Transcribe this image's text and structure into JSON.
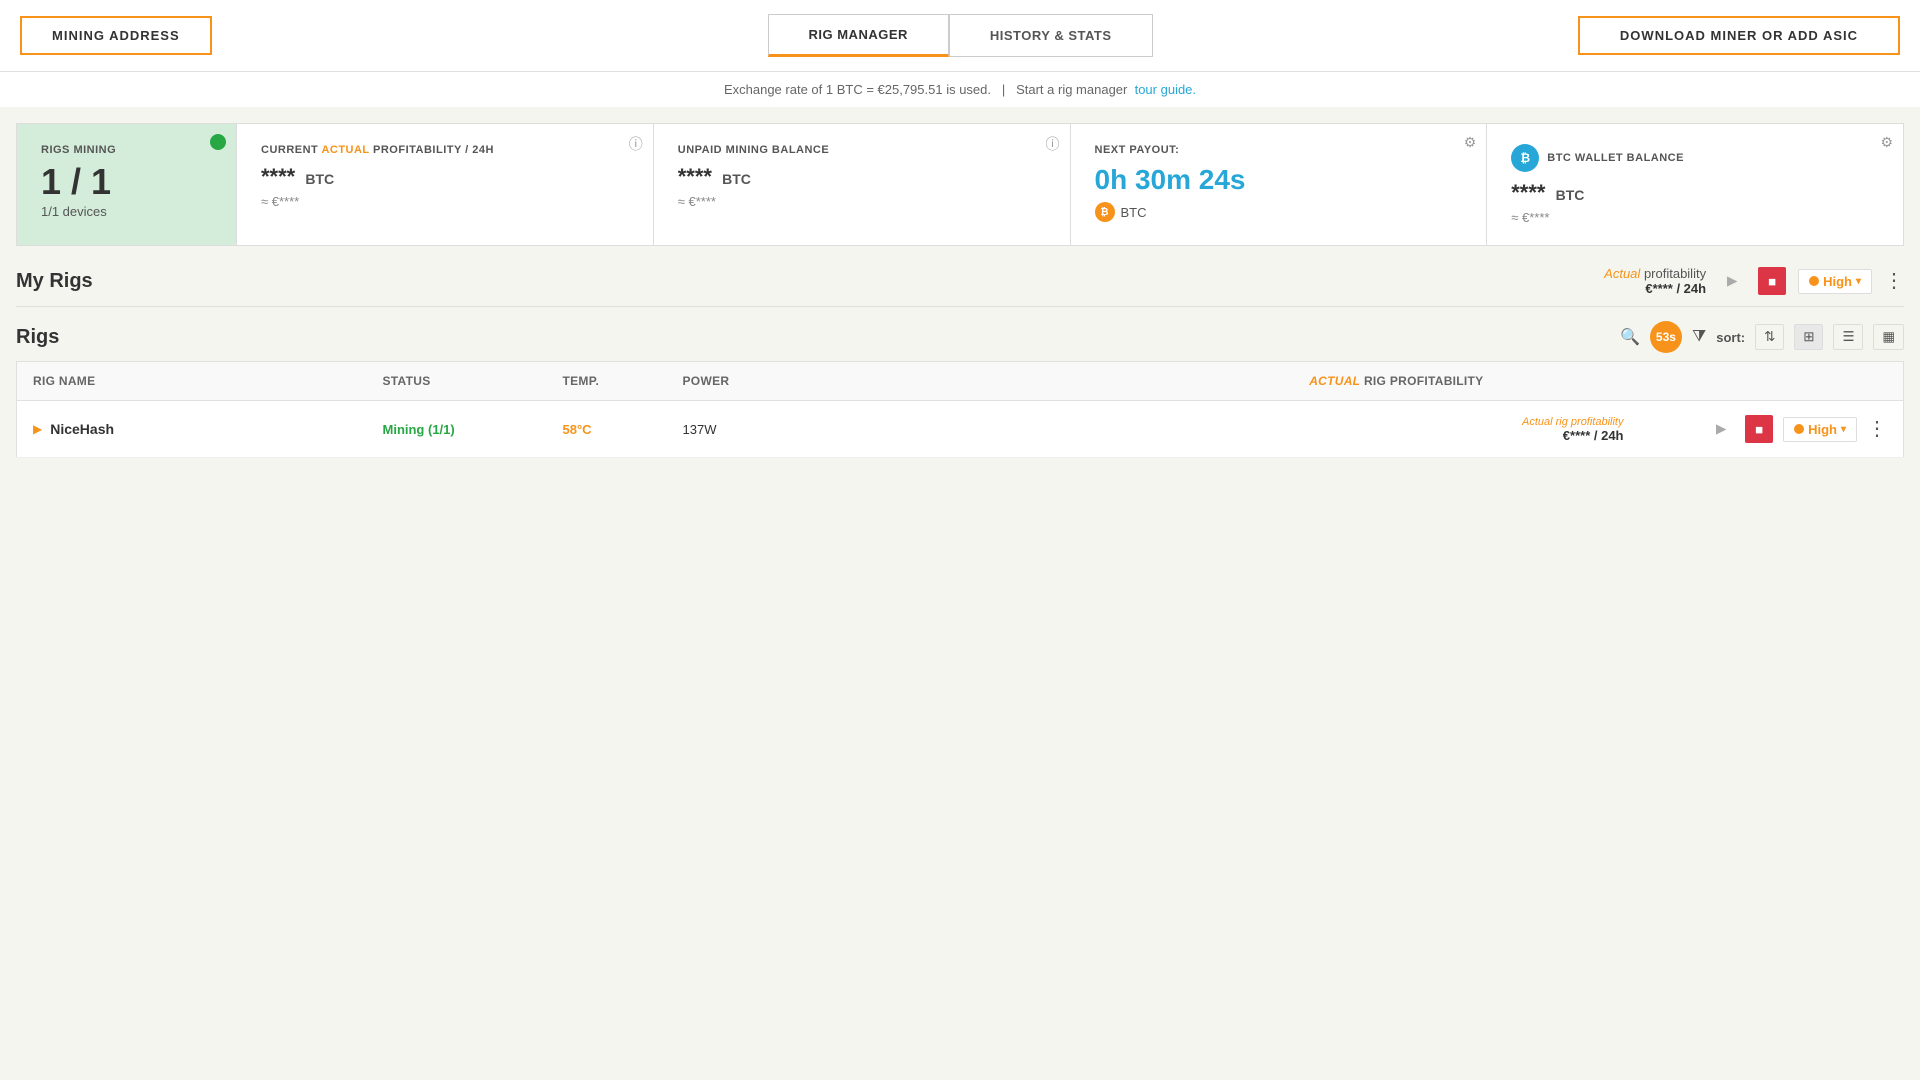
{
  "nav": {
    "mining_address_label": "MINING ADDRESS",
    "rig_manager_label": "RIG MANAGER",
    "history_stats_label": "HISTORY & STATS",
    "download_label": "DOWNLOAD MINER OR ADD ASIC"
  },
  "exchange_bar": {
    "text": "Exchange rate of 1 BTC = €25,795.51 is used.",
    "separator": "|",
    "rig_manager_text": "Start a rig manager",
    "tour_guide_link": "tour guide."
  },
  "cards": {
    "rigs_mining": {
      "label": "RIGS MINING",
      "ratio": "1 / 1",
      "devices": "1/1 devices"
    },
    "profitability": {
      "label_prefix": "CURRENT ",
      "label_actual": "ACTUAL",
      "label_suffix": " PROFITABILITY / 24H",
      "value": "****",
      "currency": "BTC",
      "approx": "≈ €****"
    },
    "unpaid_balance": {
      "label": "UNPAID MINING BALANCE",
      "value": "****",
      "currency": "BTC",
      "approx": "≈ €****"
    },
    "next_payout": {
      "label": "NEXT PAYOUT:",
      "time": "0h 30m 24s",
      "currency": "BTC",
      "approx": ""
    },
    "btc_wallet": {
      "label": "BTC WALLET BALANCE",
      "value": "****",
      "currency": "BTC",
      "approx": "≈ €****"
    }
  },
  "my_rigs": {
    "title": "My Rigs",
    "profitability_label": "Actual profitability",
    "profitability_period": "/ 24h",
    "profitability_value": "€**** / 24h",
    "actual_text": "Actual",
    "high_badge": "High",
    "play_icon": "▶",
    "stop_icon": "■",
    "more_icon": "⋮"
  },
  "rigs": {
    "title": "Rigs",
    "timer": "53s",
    "sort_label": "sort:",
    "columns": {
      "rig_name": "Rig name",
      "status": "Status",
      "temp": "Temp.",
      "power": "Power",
      "profitability": "Actual rig profitability"
    },
    "rows": [
      {
        "name": "NiceHash",
        "status": "Mining (1/1)",
        "temp": "58°C",
        "power": "137W",
        "profitability_label": "Actual rig profitability",
        "profitability_value": "€**** / 24h",
        "high_badge": "High"
      }
    ],
    "play_icon": "▶",
    "stop_icon": "■",
    "more_icon": "⋮",
    "high_badge": "High",
    "search_icon": "🔍",
    "filter_icon": "▼",
    "sort_icon": "⇅",
    "grid_icon": "⊞",
    "list_icon": "☰",
    "tiles_icon": "▦"
  }
}
